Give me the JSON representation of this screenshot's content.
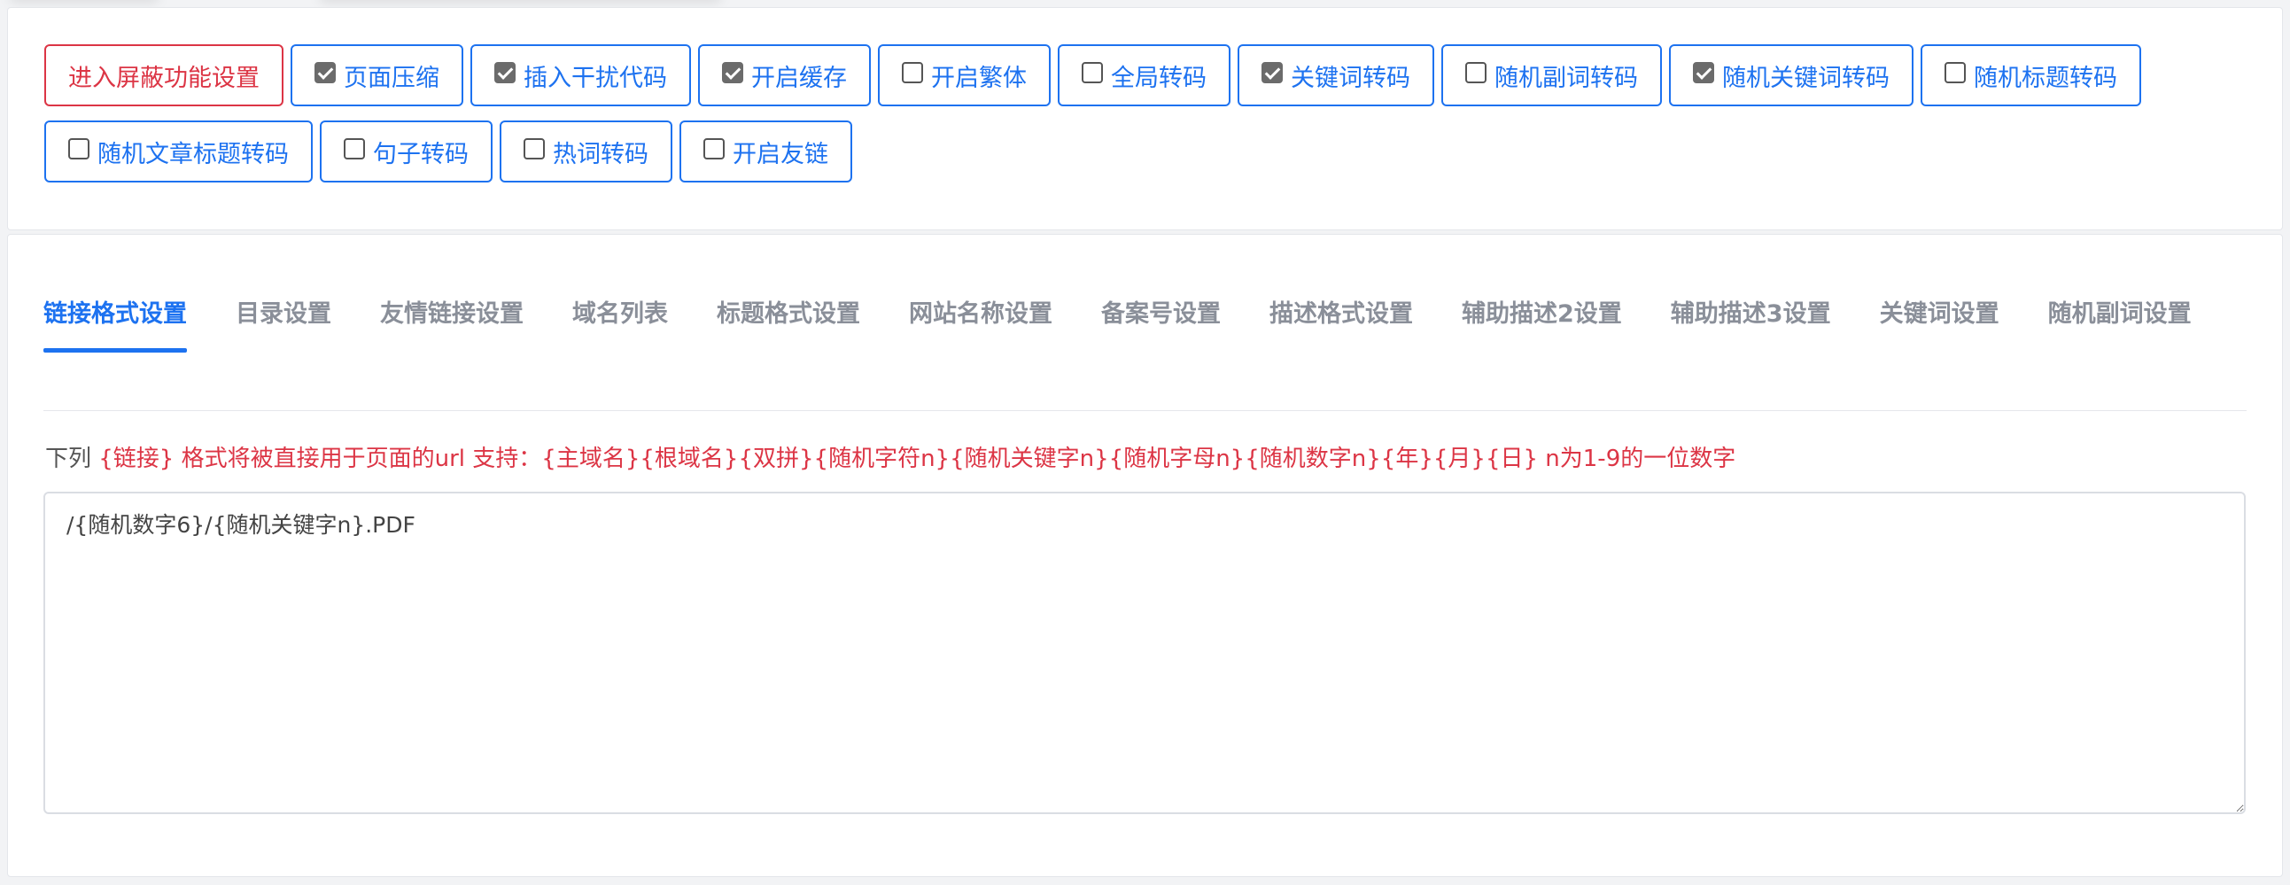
{
  "toolbar": {
    "shield_button": "进入屏蔽功能设置",
    "options": [
      {
        "label": "页面压缩",
        "checked": true
      },
      {
        "label": "插入干扰代码",
        "checked": true
      },
      {
        "label": "开启缓存",
        "checked": true
      },
      {
        "label": "开启繁体",
        "checked": false
      },
      {
        "label": "全局转码",
        "checked": false
      },
      {
        "label": "关键词转码",
        "checked": true
      },
      {
        "label": "随机副词转码",
        "checked": false
      },
      {
        "label": "随机关键词转码",
        "checked": true
      },
      {
        "label": "随机标题转码",
        "checked": false
      },
      {
        "label": "随机文章标题转码",
        "checked": false
      },
      {
        "label": "句子转码",
        "checked": false
      },
      {
        "label": "热词转码",
        "checked": false
      },
      {
        "label": "开启友链",
        "checked": false
      }
    ]
  },
  "tabs": [
    {
      "label": "链接格式设置",
      "active": true
    },
    {
      "label": "目录设置",
      "active": false
    },
    {
      "label": "友情链接设置",
      "active": false
    },
    {
      "label": "域名列表",
      "active": false
    },
    {
      "label": "标题格式设置",
      "active": false
    },
    {
      "label": "网站名称设置",
      "active": false
    },
    {
      "label": "备案号设置",
      "active": false
    },
    {
      "label": "描述格式设置",
      "active": false
    },
    {
      "label": "辅助描述2设置",
      "active": false
    },
    {
      "label": "辅助描述3设置",
      "active": false
    },
    {
      "label": "关键词设置",
      "active": false
    },
    {
      "label": "随机副词设置",
      "active": false
    }
  ],
  "hint": {
    "prefix": "下列 ",
    "tag": "{链接} 格式将被直接用于页面的url 支持：{主域名}{根域名}{双拼}{随机字符n}{随机关键字n}{随机字母n}{随机数字n}{年}{月}{日} n为1-9的一位数字"
  },
  "editor": {
    "value": "/{随机数字6}/{随机关键字n}.PDF"
  },
  "colors": {
    "primary": "#1d72f0",
    "danger": "#dc3545",
    "muted": "#8a8f99"
  }
}
